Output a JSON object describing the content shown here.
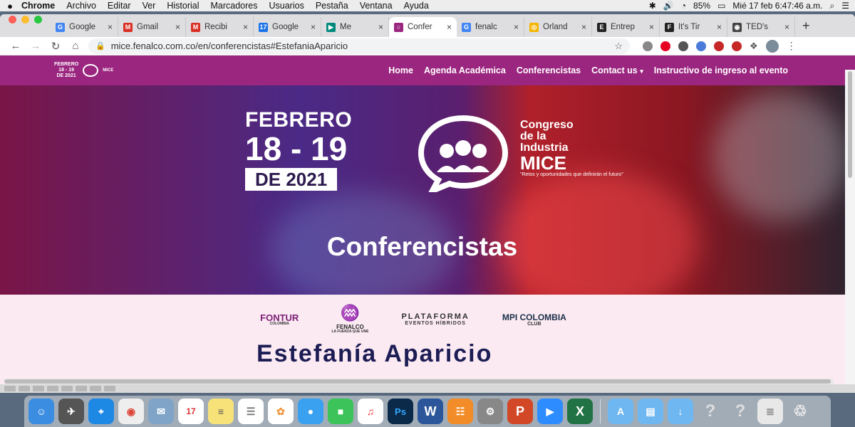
{
  "menubar": {
    "apple": "",
    "app": "Chrome",
    "items": [
      "Archivo",
      "Editar",
      "Ver",
      "Historial",
      "Marcadores",
      "Usuarios",
      "Pestaña",
      "Ventana",
      "Ayuda"
    ],
    "battery": "85%",
    "clock": "Mié 17 feb  6:47:46 a.m."
  },
  "tabs": [
    {
      "label": "Google",
      "color": "#4285f4",
      "glyph": "G"
    },
    {
      "label": "Gmail",
      "color": "#d93025",
      "glyph": "M"
    },
    {
      "label": "Recibi",
      "color": "#d93025",
      "glyph": "M"
    },
    {
      "label": "Google",
      "color": "#1a73e8",
      "glyph": "17"
    },
    {
      "label": "Me",
      "color": "#00897b",
      "glyph": "▶"
    },
    {
      "label": "Confer",
      "color": "#9b2680",
      "glyph": "○"
    },
    {
      "label": "fenalc",
      "color": "#4285f4",
      "glyph": "G"
    },
    {
      "label": "Orland",
      "color": "#f4b400",
      "glyph": "◎"
    },
    {
      "label": "Entrep",
      "color": "#222",
      "glyph": "E"
    },
    {
      "label": "It's Tir",
      "color": "#222",
      "glyph": "F"
    },
    {
      "label": "TED's",
      "color": "#444",
      "glyph": "◉"
    }
  ],
  "toolbar": {
    "url": "mice.fenalco.com.co/en/conferencistas#EstefaniaAparicio"
  },
  "site": {
    "logo": {
      "date": "FEBRERO\n18 - 19\nDE 2021",
      "mice": "MICE"
    },
    "nav": [
      "Home",
      "Agenda Académica",
      "Conferencistas",
      "Contact us",
      "Instructivo de ingreso al evento"
    ],
    "hero": {
      "date_line1": "FEBRERO",
      "date_line2": "18 - 19",
      "date_line3": "DE 2021",
      "congreso_line1": "Congreso",
      "congreso_line2": "de la",
      "congreso_line3": "Industria",
      "mice": "MICE",
      "tagline": "\"Retos y oportunidades que definirán el futuro\"",
      "title": "Conferencistas"
    },
    "sponsors": [
      {
        "name": "FONTUR",
        "sub": "COLOMBIA"
      },
      {
        "name": "FENALCO",
        "sub": "LA FUERZA QUE UNE"
      },
      {
        "name": "PLATAFORMA",
        "sub": "EVENTOS HÍBRIDOS"
      },
      {
        "name": "MPI COLOMBIA",
        "sub": "CLUB"
      }
    ],
    "speaker_partial": "Estefanía Aparicio"
  }
}
